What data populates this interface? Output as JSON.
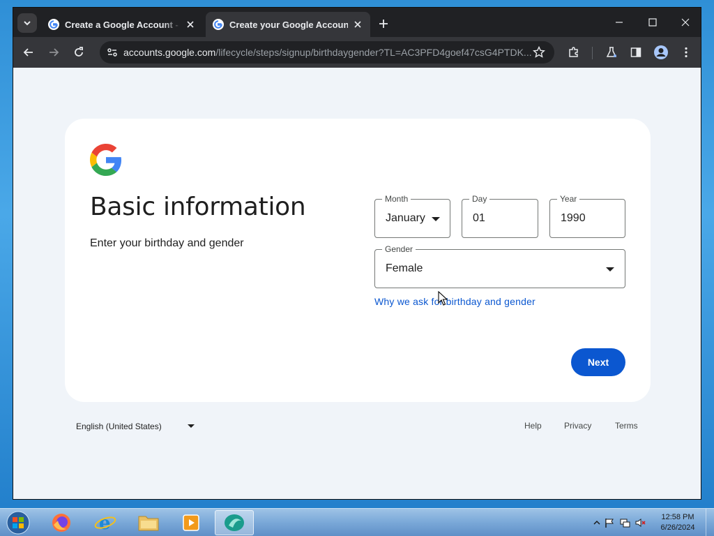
{
  "browser": {
    "tabs": [
      {
        "title": "Create a Google Account - Google",
        "active": false
      },
      {
        "title": "Create your Google Account",
        "active": true
      }
    ],
    "url_host": "accounts.google.com",
    "url_path": "/lifecycle/steps/signup/birthdaygender?TL=AC3PFD4goef47csG4PTDK..."
  },
  "page": {
    "title": "Basic information",
    "subtitle": "Enter your birthday and gender",
    "month": {
      "label": "Month",
      "value": "January"
    },
    "day": {
      "label": "Day",
      "value": "01"
    },
    "year": {
      "label": "Year",
      "value": "1990"
    },
    "gender": {
      "label": "Gender",
      "value": "Female"
    },
    "why_link": "Why we ask for birthday and gender",
    "next_button": "Next"
  },
  "footer": {
    "language": "English (United States)",
    "links": [
      "Help",
      "Privacy",
      "Terms"
    ]
  },
  "taskbar": {
    "clock_time": "12:58 PM",
    "clock_date": "6/26/2024"
  },
  "colors": {
    "google_blue": "#0b57d0",
    "page_bg": "#f0f4f9",
    "browser_dark": "#202124"
  }
}
